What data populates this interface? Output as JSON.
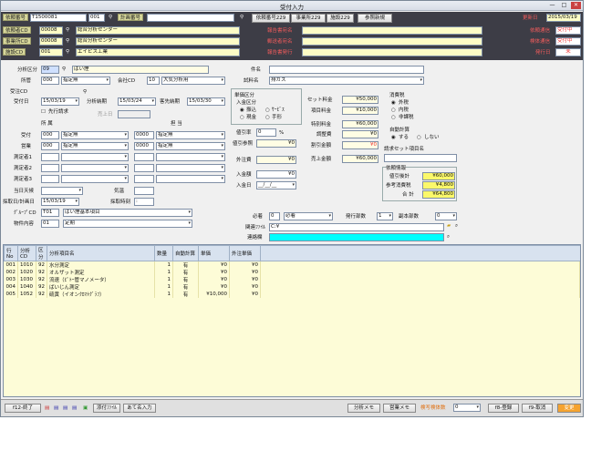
{
  "window": {
    "title": "受付入力",
    "minimize": "—",
    "maximize": "□",
    "close": "✕"
  },
  "header": {
    "row1": {
      "order_label": "依頼番号",
      "order_value": "T1500081",
      "order_sub": "001",
      "plan_label": "計画番号",
      "plan_value": "",
      "client_no_label": "依頼番号229",
      "office_no_label": "事業所229",
      "facility_label": "施設229",
      "ref_button": "参照新規",
      "updated_label": "更新日",
      "updated_value": "2015/03/19"
    },
    "rows": [
      {
        "label": "依頼者CD",
        "code": "00008",
        "name": "総合分析センター",
        "right_label": "報告書宛名",
        "status_label": "依頼通信",
        "status_value": "受付中"
      },
      {
        "label": "事業所CD",
        "code": "00008",
        "name": "総合分析センター",
        "right_label": "郵送者宛名",
        "status_label": "検体通信",
        "status_value": "受付中"
      },
      {
        "label": "施設CD",
        "code": "001",
        "name": "エイピス工業",
        "right_label": "報告書発行",
        "status_label": "発行日",
        "status_value": "未"
      }
    ]
  },
  "form": {
    "bunseki_kubun": {
      "label": "分析区分",
      "code": "09",
      "name": "ばい煙"
    },
    "shozoku": {
      "label": "所管",
      "code": "000",
      "value": "指定無"
    },
    "company": {
      "label": "会社CD",
      "code": "10",
      "value": "大気分析用"
    },
    "kenmei": {
      "label": "件名",
      "value": ""
    },
    "shiryo": {
      "label": "試料名",
      "value": "排ガス"
    },
    "uketsuke_cd": {
      "label": "受注CD"
    },
    "uketsuke_bi": {
      "label": "受付日",
      "value": "15/03/19"
    },
    "bunseki_nouki": {
      "label": "分析納期",
      "value": "15/03/24"
    },
    "kokyaku_nouki": {
      "label": "客先納期",
      "value": "15/03/30"
    },
    "sakihatsu": {
      "label": "先行請求"
    },
    "uriage_bi": {
      "label": "売上日",
      "value": ""
    },
    "col_shozoku": "所 属",
    "col_tanto": "担 当",
    "uketsuke": {
      "label": "受付",
      "code": "000",
      "value": "指定無",
      "code2": "0000",
      "value2": "指定無"
    },
    "eigyo": {
      "label": "営業",
      "code": "000",
      "value": "指定無",
      "code2": "0000",
      "value2": "指定無"
    },
    "sokutei": [
      {
        "label": "測定者1"
      },
      {
        "label": "測定者2"
      },
      {
        "label": "測定者3"
      }
    ],
    "tenki": {
      "label": "当日天候",
      "value": ""
    },
    "kion": {
      "label": "気温",
      "value": ""
    },
    "saishu": {
      "label": "採取日/計画日",
      "value": "15/03/19"
    },
    "saishu_jikan": {
      "label": "採取時刻",
      "value": ":"
    },
    "group": {
      "label": "ｸﾞﾙｰﾌﾟCD",
      "code": "T01",
      "value": "ばい煙基本項目"
    },
    "bukken": {
      "label": "物件内容",
      "code": "01",
      "value": "定期"
    },
    "tanka": {
      "label": "単価区分",
      "sub": "入金区分",
      "opt1": "現金",
      "opt2": "ｻｰﾋﾞｽ",
      "opt3": "振込",
      "opt4": "手形"
    },
    "set_ryokin": {
      "label": "セット料金",
      "value": "¥50,000"
    },
    "koumoku_ryokin": {
      "label": "項目料金",
      "value": "¥10,000"
    },
    "tokubetsu": {
      "label": "特別料金",
      "value": "¥60,000"
    },
    "chousei": {
      "label": "調整費",
      "value": "¥0"
    },
    "waribiki_kin": {
      "label": "割引金額",
      "value": "¥0"
    },
    "uriage_gaku": {
      "label": "売上金額",
      "value": "¥60,000"
    },
    "waribiki_ritsu": {
      "label": "値引率",
      "value": "0",
      "unit": "%"
    },
    "waribiki_sanko": {
      "label": "値引参照",
      "value": "¥0"
    },
    "gaichu": {
      "label": "外注費",
      "value": "¥0"
    },
    "nyukin_gaku": {
      "label": "入金額",
      "value": "¥0"
    },
    "nyukin_bi": {
      "label": "入金日",
      "value": "__/__/__"
    },
    "shohizei": {
      "label": "消費税",
      "opt1": "外税",
      "opt2": "内税",
      "opt3": "非課税"
    },
    "jidou_keisan": {
      "label": "自動計算",
      "opt1": "する",
      "opt2": "しない"
    },
    "seikyu_set": {
      "label": "請求セット項目名",
      "value": ""
    },
    "irai_joho": {
      "label": "依頼情報",
      "l1": "値引後計",
      "v1": "¥60,000",
      "l2": "参考消費税",
      "v2": "¥4,800",
      "l3": "合 計",
      "v3": "¥64,800"
    },
    "hisshu": {
      "label": "必着",
      "code": "0",
      "value": "必着"
    },
    "hakko_busu": {
      "label": "発行部数",
      "value": "1"
    },
    "fuku_busu": {
      "label": "副本部数",
      "value": "0"
    },
    "kanren": {
      "label": "関連ﾌｧｲﾙ",
      "value": "C:¥"
    },
    "bikou": {
      "label": "連絡欄",
      "value": ""
    }
  },
  "grid": {
    "headers": [
      "行No",
      "分析CD",
      "区分",
      "分析項目名",
      "数量",
      "自動計算",
      "単価",
      "外注単価"
    ],
    "rows": [
      [
        "001",
        "1010",
        "92",
        "水分測定",
        "1",
        "有",
        "¥0",
        "¥0"
      ],
      [
        "002",
        "1020",
        "92",
        "オルザット測定",
        "1",
        "有",
        "¥0",
        "¥0"
      ],
      [
        "003",
        "1030",
        "92",
        "流速（ﾋﾟﾄｰ管マノメータ）",
        "1",
        "有",
        "¥0",
        "¥0"
      ],
      [
        "004",
        "1040",
        "92",
        "ばいじん測定",
        "1",
        "有",
        "¥0",
        "¥0"
      ],
      [
        "005",
        "1052",
        "92",
        "硫黄（イオンｸﾛﾏﾄｸﾞﾗﾌ）",
        "1",
        "有",
        "¥10,000",
        "¥0"
      ]
    ]
  },
  "footer": {
    "end": "f12-終了",
    "attach": "添付ﾌｧｲﾙ",
    "address": "あて名入力",
    "memo1": "分析メモ",
    "memo2": "営業メモ",
    "sample_label": "検写検体数",
    "sample_value": "0",
    "register": "f8-登録",
    "cancel": "f9-取消",
    "change": "変更"
  }
}
